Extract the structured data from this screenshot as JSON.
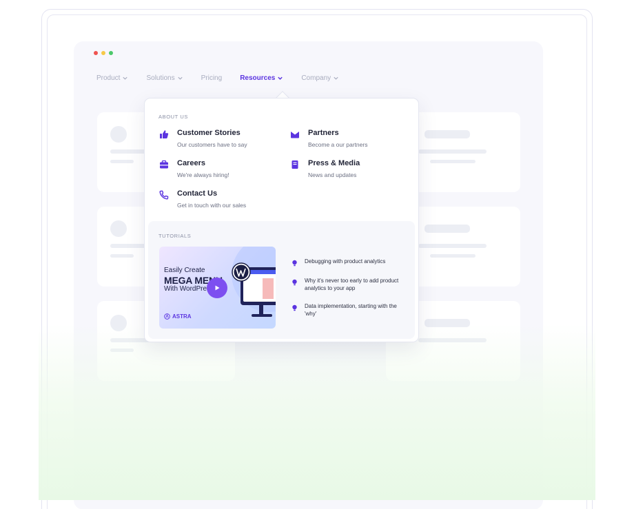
{
  "window": {
    "dot_colors": [
      "#ef5350",
      "#f7c948",
      "#4cc86a"
    ]
  },
  "nav": {
    "items": [
      {
        "label": "Product",
        "has_chevron": true
      },
      {
        "label": "Solutions",
        "has_chevron": true
      },
      {
        "label": "Pricing",
        "has_chevron": false
      },
      {
        "label": "Resources",
        "has_chevron": true,
        "active": true
      },
      {
        "label": "Company",
        "has_chevron": true
      }
    ]
  },
  "menu": {
    "about_label": "ABOUT US",
    "items": [
      {
        "title": "Customer Stories",
        "subtitle": "Our customers have to say",
        "icon": "thumbs-up-icon"
      },
      {
        "title": "Partners",
        "subtitle": "Become a our partners",
        "icon": "envelope-icon"
      },
      {
        "title": "Careers",
        "subtitle": "We're always hiring!",
        "icon": "briefcase-icon"
      },
      {
        "title": "Press & Media",
        "subtitle": "News and updates",
        "icon": "document-icon"
      },
      {
        "title": "Contact Us",
        "subtitle": "Get in touch with our sales",
        "icon": "phone-icon"
      }
    ],
    "tutorials_label": "TUTORIALS",
    "video": {
      "line1": "Easily Create",
      "line2": "MEGA MENU",
      "line3": "With WordPress",
      "brand": "ASTRA"
    },
    "tutorial_links": [
      "Debugging with product analytics",
      "Why it's never too early to add product analytics to your app",
      "Data implementation, starting with the 'why'"
    ]
  },
  "colors": {
    "accent": "#5b34e0",
    "green_wash": "#e8f9e6"
  }
}
